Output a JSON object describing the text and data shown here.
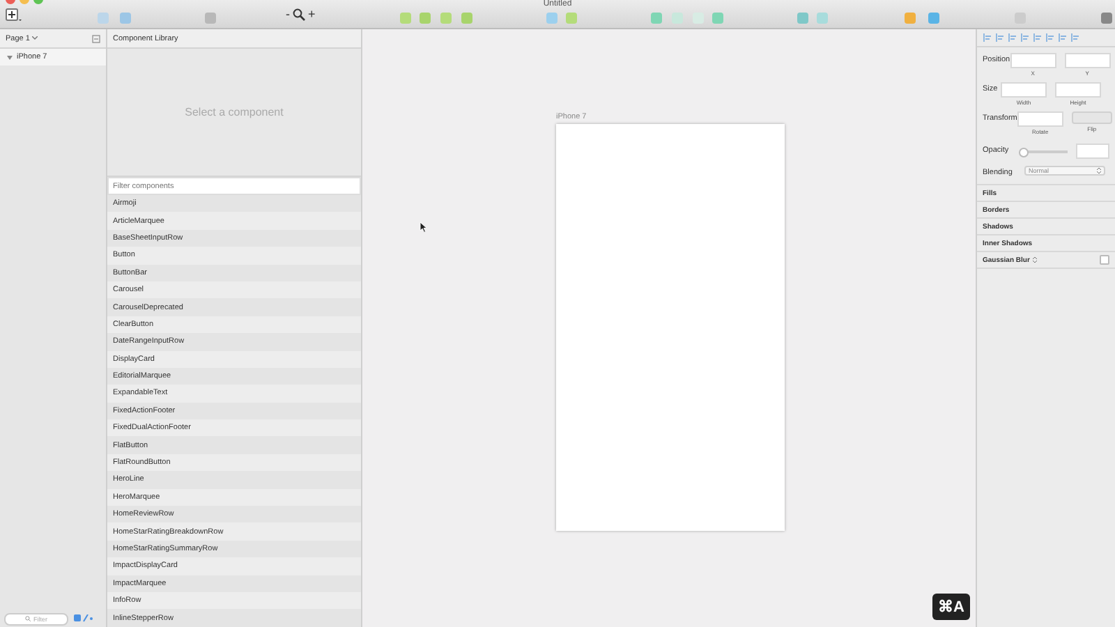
{
  "window": {
    "title": "Untitled"
  },
  "toolbar": {
    "zoom_out": "-",
    "zoom_in": "+"
  },
  "pages": {
    "current": "Page 1",
    "layers": [
      {
        "label": "iPhone 7",
        "expanded": true
      }
    ],
    "filter_placeholder": "Filter"
  },
  "library": {
    "title": "Component Library",
    "empty_message": "Select a component",
    "filter_placeholder": "Filter components",
    "items": [
      "Airmoji",
      "ArticleMarquee",
      "BaseSheetInputRow",
      "Button",
      "ButtonBar",
      "Carousel",
      "CarouselDeprecated",
      "ClearButton",
      "DateRangeInputRow",
      "DisplayCard",
      "EditorialMarquee",
      "ExpandableText",
      "FixedActionFooter",
      "FixedDualActionFooter",
      "FlatButton",
      "FlatRoundButton",
      "HeroLine",
      "HeroMarquee",
      "HomeReviewRow",
      "HomeStarRatingBreakdownRow",
      "HomeStarRatingSummaryRow",
      "ImpactDisplayCard",
      "ImpactMarquee",
      "InfoRow",
      "InlineStepperRow"
    ]
  },
  "canvas": {
    "artboard": {
      "label": "iPhone 7"
    }
  },
  "inspector": {
    "position": {
      "label": "Position",
      "x": "X",
      "y": "Y"
    },
    "size": {
      "label": "Size",
      "width": "Width",
      "height": "Height"
    },
    "transform": {
      "label": "Transform",
      "rotate": "Rotate",
      "flip": "Flip"
    },
    "opacity": {
      "label": "Opacity",
      "level": 0
    },
    "blending": {
      "label": "Blending",
      "value": "Normal"
    },
    "sections": [
      {
        "label": "Fills",
        "kind": "plain"
      },
      {
        "label": "Borders",
        "kind": "plain"
      },
      {
        "label": "Shadows",
        "kind": "plain"
      },
      {
        "label": "Inner Shadows",
        "kind": "plain"
      },
      {
        "label": "Gaussian Blur",
        "kind": "toggle",
        "checked": false
      }
    ]
  },
  "keystroke": "⌘A"
}
